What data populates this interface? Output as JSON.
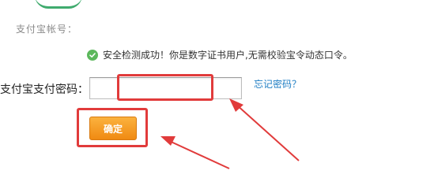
{
  "page": {
    "account_label": "支付宝帐号：",
    "security_message": "安全检测成功！你是数字证书用户,无需校验宝令动态口令。",
    "password_label": "支付宝支付密码：",
    "password_value": "",
    "forgot_link": "忘记密码？",
    "confirm_button": "确定"
  },
  "colors": {
    "highlight": "#e13b3b",
    "button": "#f08a12",
    "link": "#1f7ec4",
    "success": "#5cb85c"
  },
  "icons": {
    "success": "check-circle-icon"
  }
}
